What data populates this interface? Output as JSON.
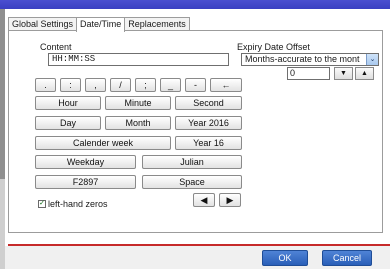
{
  "tabs": [
    {
      "label": "Global Settings",
      "active": false
    },
    {
      "label": "Date/Time",
      "active": true
    },
    {
      "label": "Replacements",
      "active": false
    }
  ],
  "content": {
    "label": "Content",
    "value": "HH:MM:SS"
  },
  "expiry": {
    "label": "Expiry Date Offset",
    "selected": "Months-accurate to the mont",
    "offset_value": "0"
  },
  "symbols": [
    ".",
    ":",
    ",",
    "/",
    ";",
    "_",
    "-",
    "←"
  ],
  "buttons": {
    "hour": "Hour",
    "minute": "Minute",
    "second": "Second",
    "day": "Day",
    "month": "Month",
    "year2016": "Year 2016",
    "calender_week": "Calender week",
    "year16": "Year 16",
    "weekday": "Weekday",
    "julian": "Julian",
    "f2897": "F2897",
    "space": "Space"
  },
  "arrows": {
    "left": "◀",
    "right": "▶",
    "down": "▼",
    "up": "▲",
    "select": "⌄"
  },
  "checkbox": {
    "label": "left-hand zeros",
    "checked": true,
    "mark": "✓"
  },
  "footer": {
    "ok": "OK",
    "cancel": "Cancel"
  },
  "colors": {
    "titlebar": "#3f45c9",
    "footer_button": "#3a6fc7",
    "accent_line": "#c62a2a"
  }
}
